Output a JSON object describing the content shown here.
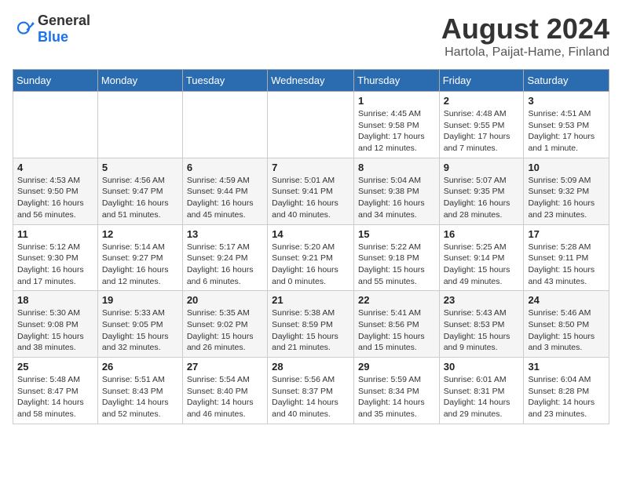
{
  "header": {
    "logo_general": "General",
    "logo_blue": "Blue",
    "month_year": "August 2024",
    "location": "Hartola, Paijat-Hame, Finland"
  },
  "weekdays": [
    "Sunday",
    "Monday",
    "Tuesday",
    "Wednesday",
    "Thursday",
    "Friday",
    "Saturday"
  ],
  "weeks": [
    [
      {
        "day": "",
        "info": ""
      },
      {
        "day": "",
        "info": ""
      },
      {
        "day": "",
        "info": ""
      },
      {
        "day": "",
        "info": ""
      },
      {
        "day": "1",
        "info": "Sunrise: 4:45 AM\nSunset: 9:58 PM\nDaylight: 17 hours\nand 12 minutes."
      },
      {
        "day": "2",
        "info": "Sunrise: 4:48 AM\nSunset: 9:55 PM\nDaylight: 17 hours\nand 7 minutes."
      },
      {
        "day": "3",
        "info": "Sunrise: 4:51 AM\nSunset: 9:53 PM\nDaylight: 17 hours\nand 1 minute."
      }
    ],
    [
      {
        "day": "4",
        "info": "Sunrise: 4:53 AM\nSunset: 9:50 PM\nDaylight: 16 hours\nand 56 minutes."
      },
      {
        "day": "5",
        "info": "Sunrise: 4:56 AM\nSunset: 9:47 PM\nDaylight: 16 hours\nand 51 minutes."
      },
      {
        "day": "6",
        "info": "Sunrise: 4:59 AM\nSunset: 9:44 PM\nDaylight: 16 hours\nand 45 minutes."
      },
      {
        "day": "7",
        "info": "Sunrise: 5:01 AM\nSunset: 9:41 PM\nDaylight: 16 hours\nand 40 minutes."
      },
      {
        "day": "8",
        "info": "Sunrise: 5:04 AM\nSunset: 9:38 PM\nDaylight: 16 hours\nand 34 minutes."
      },
      {
        "day": "9",
        "info": "Sunrise: 5:07 AM\nSunset: 9:35 PM\nDaylight: 16 hours\nand 28 minutes."
      },
      {
        "day": "10",
        "info": "Sunrise: 5:09 AM\nSunset: 9:32 PM\nDaylight: 16 hours\nand 23 minutes."
      }
    ],
    [
      {
        "day": "11",
        "info": "Sunrise: 5:12 AM\nSunset: 9:30 PM\nDaylight: 16 hours\nand 17 minutes."
      },
      {
        "day": "12",
        "info": "Sunrise: 5:14 AM\nSunset: 9:27 PM\nDaylight: 16 hours\nand 12 minutes."
      },
      {
        "day": "13",
        "info": "Sunrise: 5:17 AM\nSunset: 9:24 PM\nDaylight: 16 hours\nand 6 minutes."
      },
      {
        "day": "14",
        "info": "Sunrise: 5:20 AM\nSunset: 9:21 PM\nDaylight: 16 hours\nand 0 minutes."
      },
      {
        "day": "15",
        "info": "Sunrise: 5:22 AM\nSunset: 9:18 PM\nDaylight: 15 hours\nand 55 minutes."
      },
      {
        "day": "16",
        "info": "Sunrise: 5:25 AM\nSunset: 9:14 PM\nDaylight: 15 hours\nand 49 minutes."
      },
      {
        "day": "17",
        "info": "Sunrise: 5:28 AM\nSunset: 9:11 PM\nDaylight: 15 hours\nand 43 minutes."
      }
    ],
    [
      {
        "day": "18",
        "info": "Sunrise: 5:30 AM\nSunset: 9:08 PM\nDaylight: 15 hours\nand 38 minutes."
      },
      {
        "day": "19",
        "info": "Sunrise: 5:33 AM\nSunset: 9:05 PM\nDaylight: 15 hours\nand 32 minutes."
      },
      {
        "day": "20",
        "info": "Sunrise: 5:35 AM\nSunset: 9:02 PM\nDaylight: 15 hours\nand 26 minutes."
      },
      {
        "day": "21",
        "info": "Sunrise: 5:38 AM\nSunset: 8:59 PM\nDaylight: 15 hours\nand 21 minutes."
      },
      {
        "day": "22",
        "info": "Sunrise: 5:41 AM\nSunset: 8:56 PM\nDaylight: 15 hours\nand 15 minutes."
      },
      {
        "day": "23",
        "info": "Sunrise: 5:43 AM\nSunset: 8:53 PM\nDaylight: 15 hours\nand 9 minutes."
      },
      {
        "day": "24",
        "info": "Sunrise: 5:46 AM\nSunset: 8:50 PM\nDaylight: 15 hours\nand 3 minutes."
      }
    ],
    [
      {
        "day": "25",
        "info": "Sunrise: 5:48 AM\nSunset: 8:47 PM\nDaylight: 14 hours\nand 58 minutes."
      },
      {
        "day": "26",
        "info": "Sunrise: 5:51 AM\nSunset: 8:43 PM\nDaylight: 14 hours\nand 52 minutes."
      },
      {
        "day": "27",
        "info": "Sunrise: 5:54 AM\nSunset: 8:40 PM\nDaylight: 14 hours\nand 46 minutes."
      },
      {
        "day": "28",
        "info": "Sunrise: 5:56 AM\nSunset: 8:37 PM\nDaylight: 14 hours\nand 40 minutes."
      },
      {
        "day": "29",
        "info": "Sunrise: 5:59 AM\nSunset: 8:34 PM\nDaylight: 14 hours\nand 35 minutes."
      },
      {
        "day": "30",
        "info": "Sunrise: 6:01 AM\nSunset: 8:31 PM\nDaylight: 14 hours\nand 29 minutes."
      },
      {
        "day": "31",
        "info": "Sunrise: 6:04 AM\nSunset: 8:28 PM\nDaylight: 14 hours\nand 23 minutes."
      }
    ]
  ]
}
